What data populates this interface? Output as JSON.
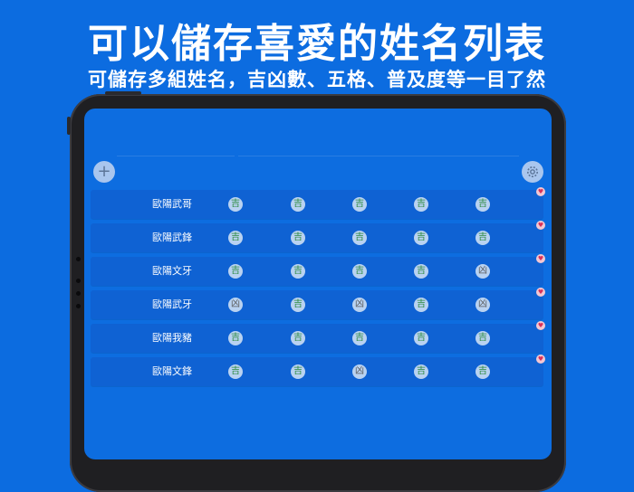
{
  "headline": "可以儲存喜愛的姓名列表",
  "subline": "可儲存多組姓名，吉凶數、五格、普及度等一目了然",
  "toolbar": {
    "add_icon": "plus-icon",
    "settings_icon": "gear-icon"
  },
  "rows": [
    {
      "name": "歐陽武哥",
      "results": [
        "吉",
        "吉",
        "吉",
        "吉",
        "吉"
      ]
    },
    {
      "name": "歐陽武鋒",
      "results": [
        "吉",
        "吉",
        "吉",
        "吉",
        "吉"
      ]
    },
    {
      "name": "歐陽文牙",
      "results": [
        "吉",
        "吉",
        "吉",
        "吉",
        "凶"
      ]
    },
    {
      "name": "歐陽武牙",
      "results": [
        "凶",
        "吉",
        "凶",
        "吉",
        "凶"
      ]
    },
    {
      "name": "歐陽我豬",
      "results": [
        "吉",
        "吉",
        "吉",
        "吉",
        "吉"
      ]
    },
    {
      "name": "歐陽文鋒",
      "results": [
        "吉",
        "吉",
        "凶",
        "吉",
        "吉"
      ]
    }
  ],
  "favorite_icon": "heart-icon",
  "colors": {
    "background": "#0c6ce0",
    "good": "#2b8a3e",
    "heart": "#d9305a"
  }
}
